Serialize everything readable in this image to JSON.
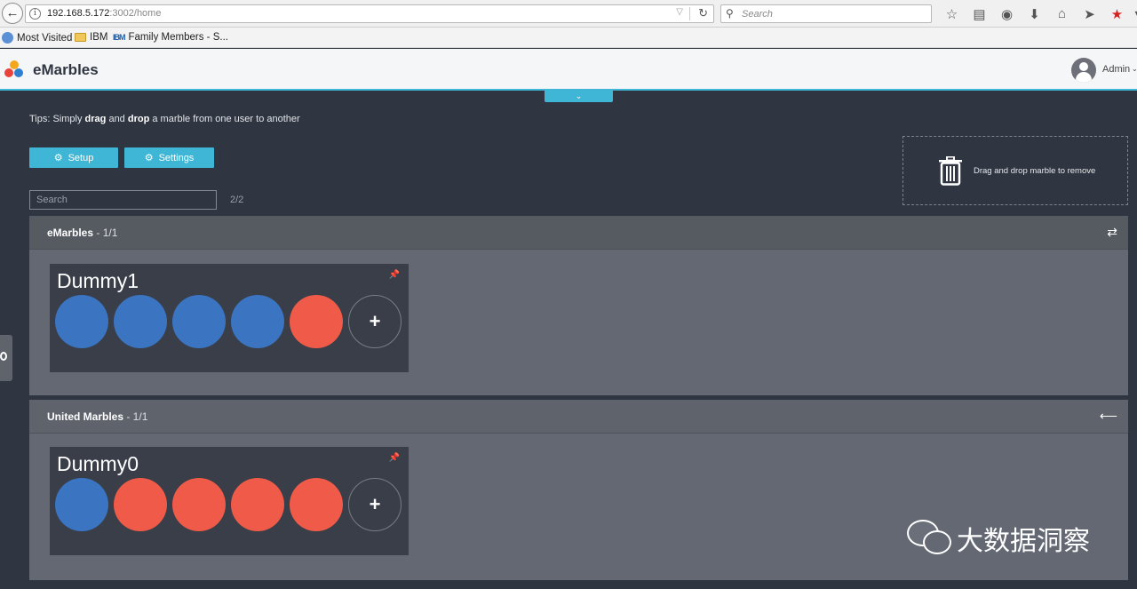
{
  "browser": {
    "url_host": "192.168.5.172",
    "url_path": ":3002/home",
    "search_placeholder": "Search",
    "bookmarks": [
      "Most Visited",
      "IBM",
      "Family Members - S..."
    ]
  },
  "app": {
    "title": "eMarbles",
    "user_label": "Admin",
    "accent_color": "#3fb6d5"
  },
  "tips": {
    "prefix": "Tips: Simply ",
    "drag": "drag",
    "mid": " and ",
    "drop": "drop",
    "suffix": " a marble from one user to another"
  },
  "toolbar": {
    "setup_label": "Setup",
    "settings_label": "Settings",
    "search_placeholder": "Search",
    "count": "2/2"
  },
  "trash": {
    "label": "Drag and drop marble to remove"
  },
  "companies": [
    {
      "name": "eMarbles",
      "count": " - 1/1",
      "action_icon": "swap-arrows-icon",
      "users": [
        {
          "name": "Dummy1",
          "marbles": [
            "blue",
            "blue",
            "blue",
            "blue",
            "red"
          ]
        }
      ]
    },
    {
      "name": "United Marbles",
      "count": " - 1/1",
      "action_icon": "arrow-left-icon",
      "users": [
        {
          "name": "Dummy0",
          "marbles": [
            "blue",
            "red",
            "red",
            "red",
            "red"
          ]
        }
      ]
    }
  ],
  "colors": {
    "blue": "#3b74c0",
    "red": "#f05a48"
  },
  "watermark": {
    "text": "大数据洞察"
  }
}
